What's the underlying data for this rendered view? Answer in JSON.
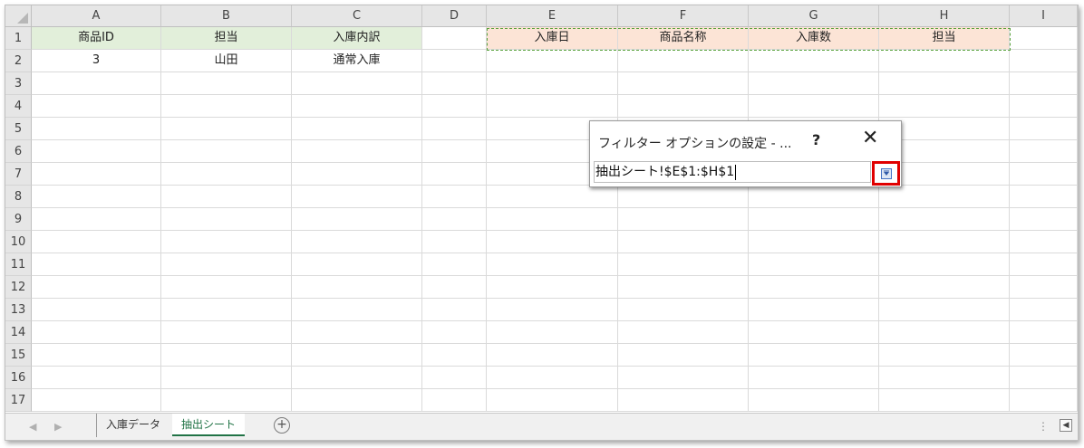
{
  "columns": [
    "A",
    "B",
    "C",
    "D",
    "E",
    "F",
    "G",
    "H",
    "I"
  ],
  "rows": [
    "1",
    "2",
    "3",
    "4",
    "5",
    "6",
    "7",
    "8",
    "9",
    "10",
    "11",
    "12",
    "13",
    "14",
    "15",
    "16",
    "17"
  ],
  "cells": {
    "A1": "商品ID",
    "B1": "担当",
    "C1": "入庫内訳",
    "E1": "入庫日",
    "F1": "商品名称",
    "G1": "入庫数",
    "H1": "担当",
    "A2": "3",
    "B2": "山田",
    "C2": "通常入庫"
  },
  "colors": {
    "criteria_header_fill": "#e2efda",
    "extract_header_fill": "#fce4d6",
    "marquee": "#5aa33d",
    "highlight_border": "#e00000",
    "active_tab_accent": "#217346"
  },
  "dialog": {
    "title": "フィルター オプションの設定 - ...",
    "help_label": "?",
    "close_label": "✕",
    "reference_value": "抽出シート!$E$1:$H$1",
    "collapse_icon": "expand-dialog-icon"
  },
  "sheet_tabs": {
    "tabs": [
      {
        "label": "入庫データ",
        "active": false
      },
      {
        "label": "抽出シート",
        "active": true
      }
    ],
    "add_label": "+",
    "prev_arrow": "◀",
    "next_arrow": "▶",
    "more_label": "⋮",
    "scroll_label": "◀"
  }
}
